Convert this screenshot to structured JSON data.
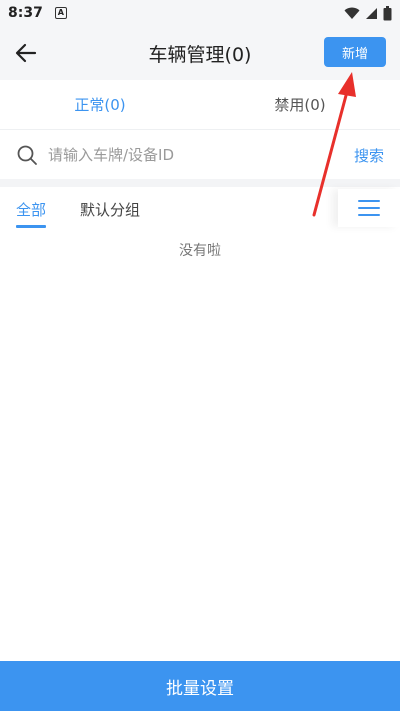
{
  "status_bar": {
    "time": "8:37",
    "app_icon_letter": "A"
  },
  "header": {
    "title": "车辆管理(0)",
    "add_label": "新增"
  },
  "status_tabs": [
    {
      "label": "正常(0)",
      "active": true
    },
    {
      "label": "禁用(0)",
      "active": false
    }
  ],
  "search": {
    "placeholder": "请输入车牌/设备ID",
    "value": "",
    "button_label": "搜索"
  },
  "group_tabs": [
    {
      "label": "全部",
      "active": true
    },
    {
      "label": "默认分组",
      "active": false
    }
  ],
  "empty_message": "没有啦",
  "bottom_button": "批量设置",
  "colors": {
    "accent": "#3c94f0",
    "annotation": "#e8302b"
  },
  "icons": [
    "back-arrow-icon",
    "search-icon",
    "menu-icon",
    "wifi-icon",
    "signal-icon",
    "battery-icon"
  ]
}
